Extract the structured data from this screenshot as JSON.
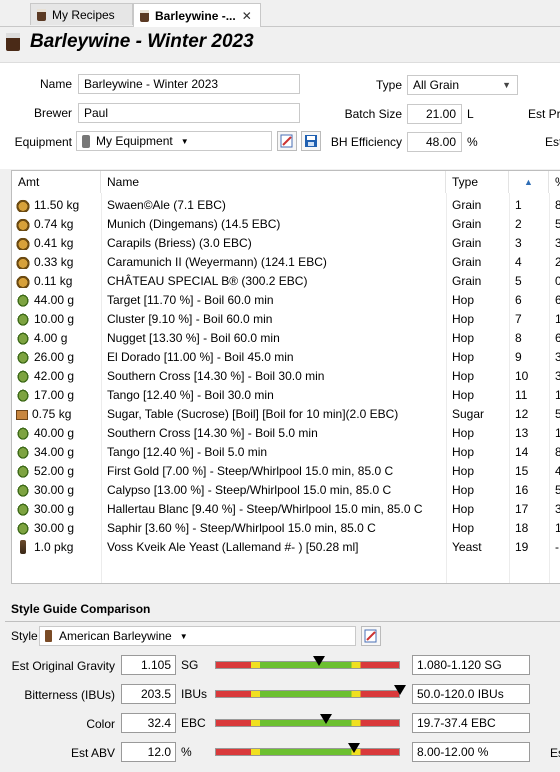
{
  "tabs": [
    {
      "label": "My Recipes",
      "active": false
    },
    {
      "label": "Barleywine -...",
      "active": true
    }
  ],
  "header": {
    "title": "Barleywine - Winter 2023"
  },
  "form": {
    "name_label": "Name",
    "name_value": "Barleywine - Winter 2023",
    "brewer_label": "Brewer",
    "brewer_value": "Paul",
    "equipment_label": "Equipment",
    "equipment_value": "My Equipment",
    "type_label": "Type",
    "type_value": "All Grain",
    "batch_label": "Batch Size",
    "batch_value": "21.00",
    "batch_unit": "L",
    "bh_label": "BH Efficiency",
    "bh_value": "48.00",
    "bh_unit": "%",
    "est_pre_label": "Est Pre",
    "est_label": "Est"
  },
  "table": {
    "columns": [
      "Amt",
      "Name",
      "Type",
      "",
      "%"
    ],
    "rows": [
      {
        "icon": "grain",
        "amt": "11.50 kg",
        "name": "Swaen©Ale (7.1 EBC)",
        "type": "Grain",
        "num": "1",
        "pct": "8"
      },
      {
        "icon": "grain",
        "amt": "0.74 kg",
        "name": "Munich (Dingemans) (14.5 EBC)",
        "type": "Grain",
        "num": "2",
        "pct": "5"
      },
      {
        "icon": "grain",
        "amt": "0.41 kg",
        "name": "Carapils (Briess) (3.0 EBC)",
        "type": "Grain",
        "num": "3",
        "pct": "3"
      },
      {
        "icon": "grain",
        "amt": "0.33 kg",
        "name": "Caramunich II (Weyermann) (124.1 EBC)",
        "type": "Grain",
        "num": "4",
        "pct": "2"
      },
      {
        "icon": "grain",
        "amt": "0.11 kg",
        "name": "CHÂTEAU SPECIAL B® (300.2 EBC)",
        "type": "Grain",
        "num": "5",
        "pct": "0"
      },
      {
        "icon": "hop",
        "amt": "44.00 g",
        "name": "Target [11.70 %] - Boil 60.0 min",
        "type": "Hop",
        "num": "6",
        "pct": "6"
      },
      {
        "icon": "hop",
        "amt": "10.00 g",
        "name": "Cluster [9.10 %] - Boil 60.0 min",
        "type": "Hop",
        "num": "7",
        "pct": "1"
      },
      {
        "icon": "hop",
        "amt": "4.00 g",
        "name": "Nugget [13.30 %] - Boil 60.0 min",
        "type": "Hop",
        "num": "8",
        "pct": "6"
      },
      {
        "icon": "hop",
        "amt": "26.00 g",
        "name": "El Dorado [11.00 %] - Boil 45.0 min",
        "type": "Hop",
        "num": "9",
        "pct": "3"
      },
      {
        "icon": "hop",
        "amt": "42.00 g",
        "name": "Southern Cross [14.30 %] - Boil 30.0 min",
        "type": "Hop",
        "num": "10",
        "pct": "3"
      },
      {
        "icon": "hop",
        "amt": "17.00 g",
        "name": "Tango [12.40 %] - Boil 30.0 min",
        "type": "Hop",
        "num": "11",
        "pct": "1"
      },
      {
        "icon": "sugar",
        "amt": "0.75 kg",
        "name": "Sugar, Table (Sucrose) [Boil] [Boil for 10 min](2.0 EBC)",
        "type": "Sugar",
        "num": "12",
        "pct": "5"
      },
      {
        "icon": "hop",
        "amt": "40.00 g",
        "name": "Southern Cross [14.30 %] - Boil 5.0 min",
        "type": "Hop",
        "num": "13",
        "pct": "1"
      },
      {
        "icon": "hop",
        "amt": "34.00 g",
        "name": "Tango [12.40 %] - Boil 5.0 min",
        "type": "Hop",
        "num": "14",
        "pct": "8"
      },
      {
        "icon": "hop",
        "amt": "52.00 g",
        "name": "First Gold [7.00 %] - Steep/Whirlpool  15.0 min, 85.0 C",
        "type": "Hop",
        "num": "15",
        "pct": "4"
      },
      {
        "icon": "hop",
        "amt": "30.00 g",
        "name": "Calypso [13.00 %] - Steep/Whirlpool  15.0 min, 85.0 C",
        "type": "Hop",
        "num": "16",
        "pct": "5"
      },
      {
        "icon": "hop",
        "amt": "30.00 g",
        "name": "Hallertau Blanc [9.40 %] - Steep/Whirlpool  15.0 min, 85.0 C",
        "type": "Hop",
        "num": "17",
        "pct": "3"
      },
      {
        "icon": "hop",
        "amt": "30.00 g",
        "name": "Saphir [3.60 %] - Steep/Whirlpool  15.0 min, 85.0 C",
        "type": "Hop",
        "num": "18",
        "pct": "1"
      },
      {
        "icon": "yeast",
        "amt": "1.0 pkg",
        "name": "Voss Kveik Ale Yeast (Lallemand #- ) [50.28 ml]",
        "type": "Yeast",
        "num": "19",
        "pct": "-"
      }
    ]
  },
  "style_guide": {
    "title": "Style Guide Comparison",
    "style_label": "Style",
    "style_value": "American Barleywine",
    "est_right_label": "Es",
    "metrics": [
      {
        "label": "Est Original Gravity",
        "value": "1.105",
        "unit": "SG",
        "range": "1.080-1.120 SG",
        "position": 0.56
      },
      {
        "label": "Bitterness (IBUs)",
        "value": "203.5",
        "unit": "IBUs",
        "range": "50.0-120.0 IBUs",
        "position": 1.0
      },
      {
        "label": "Color",
        "value": "32.4",
        "unit": "EBC",
        "range": "19.7-37.4 EBC",
        "position": 0.6
      },
      {
        "label": "Est ABV",
        "value": "12.0",
        "unit": "%",
        "range": "8.00-12.00 %",
        "position": 0.75
      }
    ]
  }
}
